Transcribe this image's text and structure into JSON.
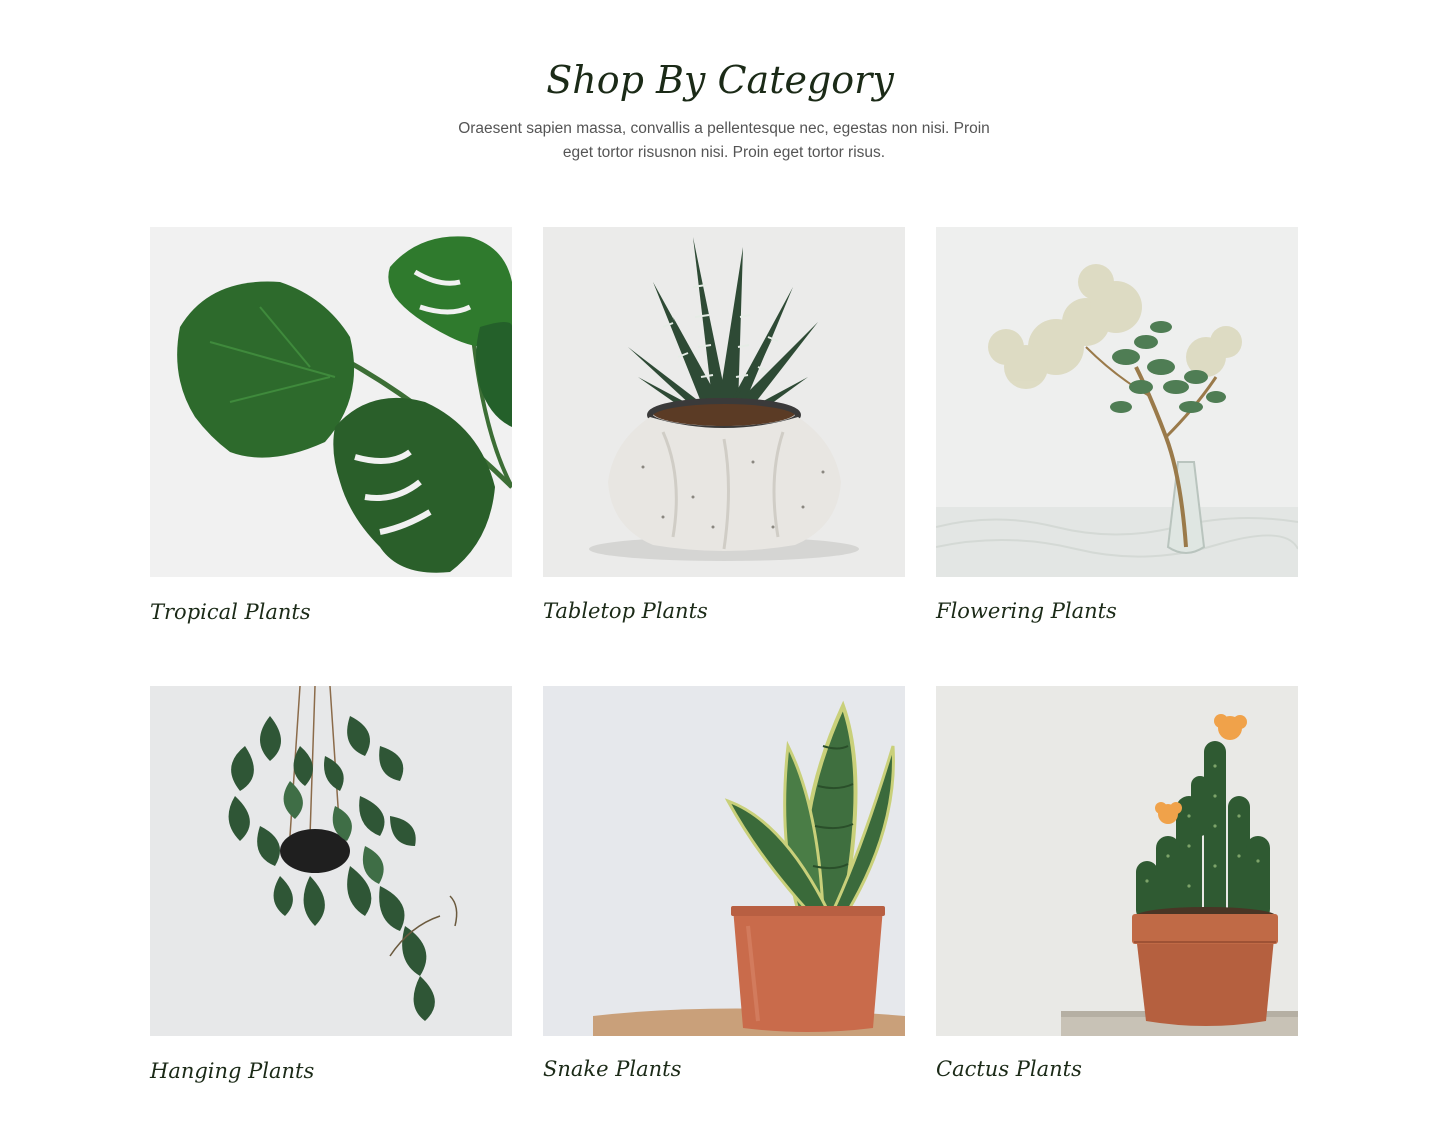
{
  "section": {
    "title": "Shop By Category",
    "subtitle_line1": "Oraesent sapien massa, convallis a pellentesque nec, egestas non nisi. Proin",
    "subtitle_line2": "eget tortor risusnon nisi. Proin eget tortor risus."
  },
  "categories": [
    {
      "title": "Tropical Plants",
      "image": "monstera-leaves-image"
    },
    {
      "title": "Tabletop Plants",
      "image": "zebra-succulent-pot-image"
    },
    {
      "title": "Flowering Plants",
      "image": "dried-flowers-vase-image"
    },
    {
      "title": "Hanging Plants",
      "image": "hanging-pothos-image"
    },
    {
      "title": "Snake Plants",
      "image": "snake-plant-terracotta-image"
    },
    {
      "title": "Cactus Plants",
      "image": "flowering-cactus-image"
    }
  ],
  "colors": {
    "heading": "#1b2a17",
    "body_text": "#555555",
    "image_bg": "#f0f0f0",
    "leaf_green": "#2e6b2f",
    "terracotta": "#c96b4b"
  }
}
